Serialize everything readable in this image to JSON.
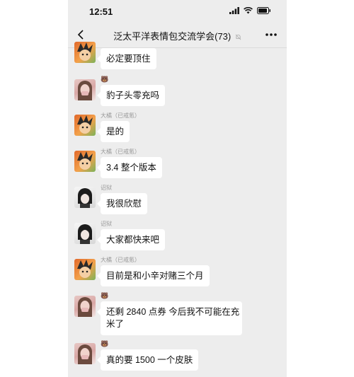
{
  "status": {
    "time": "12:51"
  },
  "header": {
    "title": "泛太平洋表情包交流学会(73)"
  },
  "messages": [
    {
      "sender": "",
      "text": "必定要顶住",
      "avatar": "orange-character-avatar"
    },
    {
      "sender": "🐻",
      "text": "豹子头零充吗",
      "avatar": "girl-avatar"
    },
    {
      "sender": "大橘（已戒氪）",
      "text": "是的",
      "avatar": "orange-character-avatar"
    },
    {
      "sender": "大橘（已戒氪）",
      "text": "3.4 整个版本",
      "avatar": "orange-character-avatar"
    },
    {
      "sender": "诏狱",
      "text": "我很欣慰",
      "avatar": "dark-hair-avatar"
    },
    {
      "sender": "诏狱",
      "text": "大家都快来吧",
      "avatar": "dark-hair-avatar"
    },
    {
      "sender": "大橘（已戒氪）",
      "text": "目前是和小辛对赌三个月",
      "avatar": "orange-character-avatar"
    },
    {
      "sender": "🐻",
      "text_line1": "还剩 2840 点券 今后我不可能在充",
      "text_line2": "米了",
      "avatar": "girl-avatar"
    },
    {
      "sender": "🐻",
      "text": "真的要 1500 一个皮肤",
      "avatar": "girl-avatar"
    }
  ]
}
